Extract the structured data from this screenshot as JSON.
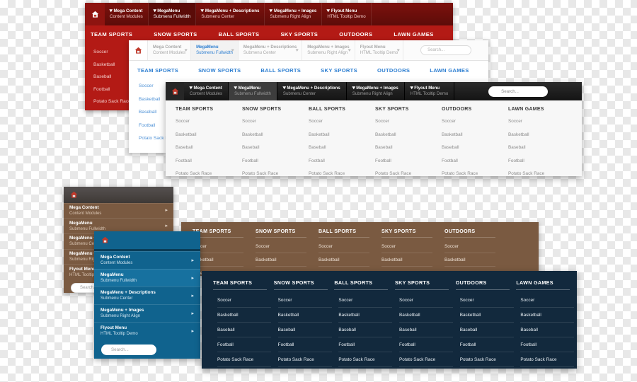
{
  "nav_items": [
    {
      "l1": "Mega Content",
      "l2": "Content Modules"
    },
    {
      "l1": "MegaMenu",
      "l2": "Submenu Fullwidth"
    },
    {
      "l1": "MegaMenu + Descriptions",
      "l2": "Submenu Center"
    },
    {
      "l1": "MegaMenu + Images",
      "l2": "Submenu Right Align"
    },
    {
      "l1": "Flyout Menu",
      "l2": "HTML Tooltip Demo"
    }
  ],
  "sections": [
    "TEAM SPORTS",
    "SNOW SPORTS",
    "BALL SPORTS",
    "SKY SPORTS",
    "OUTDOORS",
    "LAWN GAMES"
  ],
  "sports": [
    "Soccer",
    "Basketball",
    "Baseball",
    "Football",
    "Potato Sack Race"
  ],
  "search": {
    "placeholder": "Search...",
    "value": ""
  },
  "icons": {
    "home": "home-icon",
    "caret": "▾",
    "arrow": "▸"
  },
  "colors": {
    "red": "#b31a15",
    "red_dark": "#6e0f0c",
    "blue_link": "#2e7fd1",
    "dark": "#1d1d1d",
    "brown": "#7a5a41",
    "blue": "#10638e",
    "navy": "#12293d"
  },
  "panels": {
    "red": {
      "name": "Red Mega Menu",
      "active_index": 1
    },
    "white": {
      "name": "White Mega Menu",
      "active_index": 1
    },
    "dark": {
      "name": "Dark Mega Menu",
      "active_index": 1
    },
    "brown_vertical": {
      "name": "Brown Vertical Menu",
      "active_index": -1
    },
    "brown_mega": {
      "name": "Brown Mega Panel"
    },
    "blue_vertical": {
      "name": "Blue Vertical Menu",
      "active_index": 1
    },
    "navy_mega": {
      "name": "Navy Mega Panel"
    }
  }
}
